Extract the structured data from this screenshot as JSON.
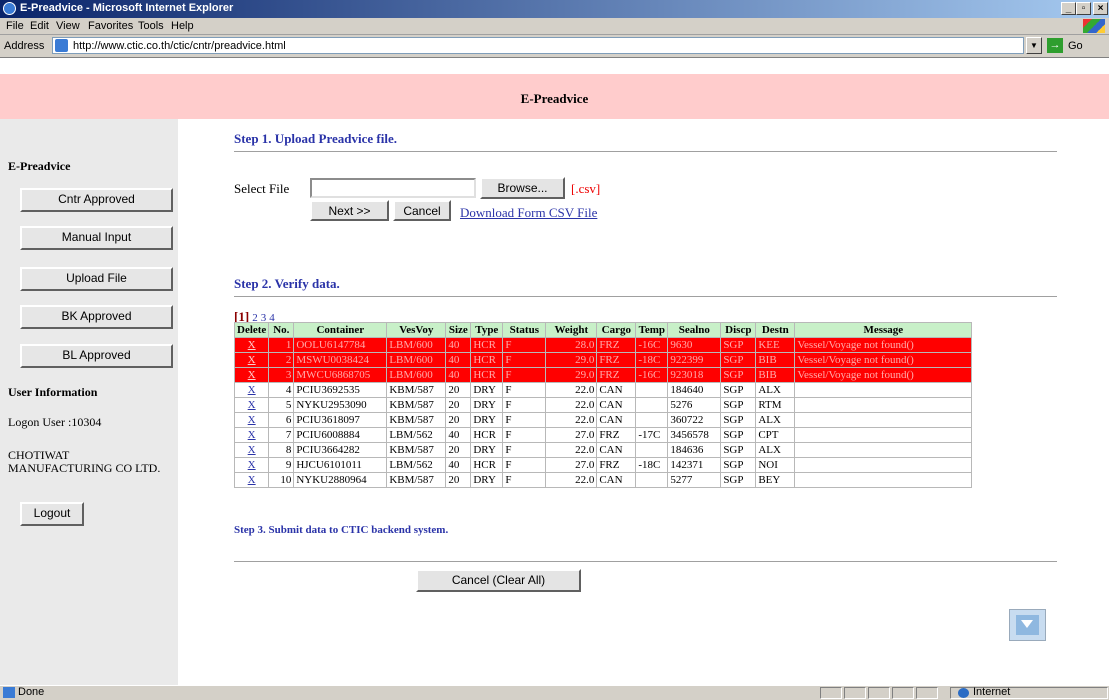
{
  "window": {
    "title": "E-Preadvice - Microsoft Internet Explorer"
  },
  "menu": [
    "File",
    "Edit",
    "View",
    "Favorites",
    "Tools",
    "Help"
  ],
  "address": {
    "label": "Address",
    "url": "http://www.ctic.co.th/ctic/cntr/preadvice.html",
    "go_label": "Go"
  },
  "header": {
    "title": "E-Preadvice"
  },
  "sidebar": {
    "section_title": "E-Preadvice",
    "buttons": [
      "Cntr Approved",
      "Manual  Input",
      "Upload  File",
      "BK Approved",
      "BL Approved"
    ],
    "user_info_title": "User Information",
    "logon_user": "Logon User :10304",
    "company": "CHOTIWAT MANUFACTURING CO LTD.",
    "logout": "Logout"
  },
  "step1": {
    "title": "Step 1. Upload Preadvice file.",
    "select_file_label": "Select File",
    "file_value": "",
    "browse_label": "Browse...",
    "csv_hint": "[.csv]",
    "next_label": "Next >>",
    "cancel_label": "Cancel",
    "download_link": "Download Form CSV File"
  },
  "step2": {
    "title": "Step 2. Verify data.",
    "pages": [
      "1",
      "2",
      "3",
      "4"
    ],
    "current_page": "1",
    "columns": [
      "Delete",
      "No.",
      "Container",
      "VesVoy",
      "Size",
      "Type",
      "Status",
      "Weight",
      "Cargo",
      "Temp",
      "Sealno",
      "Discp",
      "Destn",
      "Message"
    ],
    "rows": [
      {
        "del": "X",
        "no": "1",
        "container": "OOLU6147784",
        "vesvoy": "LBM/600",
        "size": "40",
        "type": "HCR",
        "status": "F",
        "weight": "28.0",
        "cargo": "FRZ",
        "temp": "-16C",
        "sealno": "9630",
        "discp": "SGP",
        "destn": "KEE",
        "message": "Vessel/Voyage not found()",
        "error": true
      },
      {
        "del": "X",
        "no": "2",
        "container": "MSWU0038424",
        "vesvoy": "LBM/600",
        "size": "40",
        "type": "HCR",
        "status": "F",
        "weight": "29.0",
        "cargo": "FRZ",
        "temp": "-18C",
        "sealno": "922399",
        "discp": "SGP",
        "destn": "BIB",
        "message": "Vessel/Voyage not found()",
        "error": true
      },
      {
        "del": "X",
        "no": "3",
        "container": "MWCU6868705",
        "vesvoy": "LBM/600",
        "size": "40",
        "type": "HCR",
        "status": "F",
        "weight": "29.0",
        "cargo": "FRZ",
        "temp": "-16C",
        "sealno": "923018",
        "discp": "SGP",
        "destn": "BIB",
        "message": "Vessel/Voyage not found()",
        "error": true
      },
      {
        "del": "X",
        "no": "4",
        "container": "PCIU3692535",
        "vesvoy": "KBM/587",
        "size": "20",
        "type": "DRY",
        "status": "F",
        "weight": "22.0",
        "cargo": "CAN",
        "temp": "",
        "sealno": "184640",
        "discp": "SGP",
        "destn": "ALX",
        "message": "",
        "error": false
      },
      {
        "del": "X",
        "no": "5",
        "container": "NYKU2953090",
        "vesvoy": "KBM/587",
        "size": "20",
        "type": "DRY",
        "status": "F",
        "weight": "22.0",
        "cargo": "CAN",
        "temp": "",
        "sealno": "5276",
        "discp": "SGP",
        "destn": "RTM",
        "message": "",
        "error": false
      },
      {
        "del": "X",
        "no": "6",
        "container": "PCIU3618097",
        "vesvoy": "KBM/587",
        "size": "20",
        "type": "DRY",
        "status": "F",
        "weight": "22.0",
        "cargo": "CAN",
        "temp": "",
        "sealno": "360722",
        "discp": "SGP",
        "destn": "ALX",
        "message": "",
        "error": false
      },
      {
        "del": "X",
        "no": "7",
        "container": "PCIU6008884",
        "vesvoy": "LBM/562",
        "size": "40",
        "type": "HCR",
        "status": "F",
        "weight": "27.0",
        "cargo": "FRZ",
        "temp": "-17C",
        "sealno": "3456578",
        "discp": "SGP",
        "destn": "CPT",
        "message": "",
        "error": false
      },
      {
        "del": "X",
        "no": "8",
        "container": "PCIU3664282",
        "vesvoy": "KBM/587",
        "size": "20",
        "type": "DRY",
        "status": "F",
        "weight": "22.0",
        "cargo": "CAN",
        "temp": "",
        "sealno": "184636",
        "discp": "SGP",
        "destn": "ALX",
        "message": "",
        "error": false
      },
      {
        "del": "X",
        "no": "9",
        "container": "HJCU6101011",
        "vesvoy": "LBM/562",
        "size": "40",
        "type": "HCR",
        "status": "F",
        "weight": "27.0",
        "cargo": "FRZ",
        "temp": "-18C",
        "sealno": "142371",
        "discp": "SGP",
        "destn": "NOI",
        "message": "",
        "error": false
      },
      {
        "del": "X",
        "no": "10",
        "container": "NYKU2880964",
        "vesvoy": "KBM/587",
        "size": "20",
        "type": "DRY",
        "status": "F",
        "weight": "22.0",
        "cargo": "CAN",
        "temp": "",
        "sealno": "5277",
        "discp": "SGP",
        "destn": "BEY",
        "message": "",
        "error": false
      }
    ]
  },
  "step3": {
    "title": "Step 3. Submit data to CTIC backend system.",
    "cancel_all_label": "Cancel (Clear All)"
  },
  "status": {
    "text": "Done",
    "zone": "Internet"
  },
  "colors": {
    "header_bg": "#ffcccc",
    "step_title": "#2a33a8",
    "error_row": "#ff0000",
    "table_header": "#c8f0c8",
    "sidebar_bg": "#eaeaea"
  }
}
